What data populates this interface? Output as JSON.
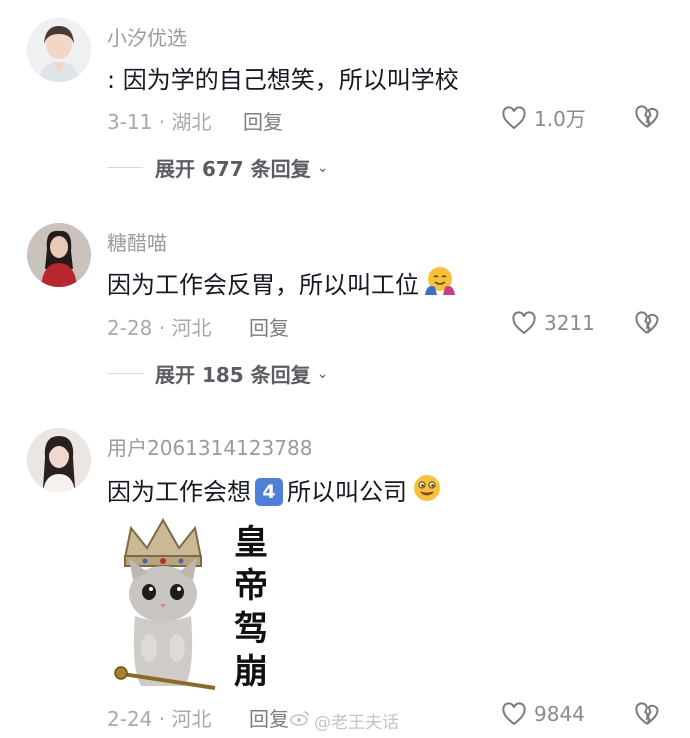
{
  "comments": [
    {
      "username": "小汐优选",
      "text": ": 因为学的自己想笑，所以叫学校",
      "date_location": "3-11 · 湖北",
      "reply_label": "回复",
      "likes": "1.0万",
      "expand": {
        "count_text": "展开 677 条回复"
      }
    },
    {
      "username": "糖醋喵",
      "text": "因为工作会反胃，所以叫工位",
      "date_location": "2-28 · 河北",
      "reply_label": "回复",
      "likes": "3211",
      "expand": {
        "count_text": "展开 185 条回复"
      }
    },
    {
      "username": "用户2061314123788",
      "text_before": "因为工作会想",
      "keycap": "4",
      "text_after": "所以叫公司",
      "sticker_text": "皇帝驾崩",
      "date_location": "2-24 · 河北",
      "reply_label": "回复",
      "likes": "9844"
    }
  ],
  "watermark": "@老王夫话",
  "icons": {
    "like": "heart-outline-icon",
    "dislike": "broken-heart-icon",
    "expand": "chevron-down-icon"
  },
  "colors": {
    "text": "#161823",
    "muted": "#a8a8ae",
    "link": "#5c5c63"
  }
}
